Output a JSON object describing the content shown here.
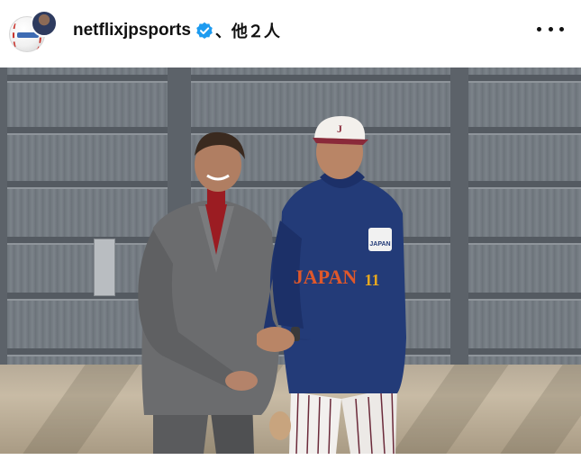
{
  "post": {
    "account_name": "netflixjpsports",
    "coauthors": "、他２人",
    "verified_icon": "verified-badge-icon",
    "more_icon": "more-horizontal-icon",
    "avatar_icon": "baseball-avatar-icon"
  },
  "photo": {
    "jersey_text": "JAPAN",
    "jersey_number": "11",
    "cap_letter": "J",
    "patch_text": "JAPAN"
  },
  "colors": {
    "verified": "#1d9bf0",
    "jersey": "#233b78",
    "jersey_lettering": "#e0582a",
    "suit": "#6d6e70",
    "turtleneck": "#9e1b22"
  }
}
